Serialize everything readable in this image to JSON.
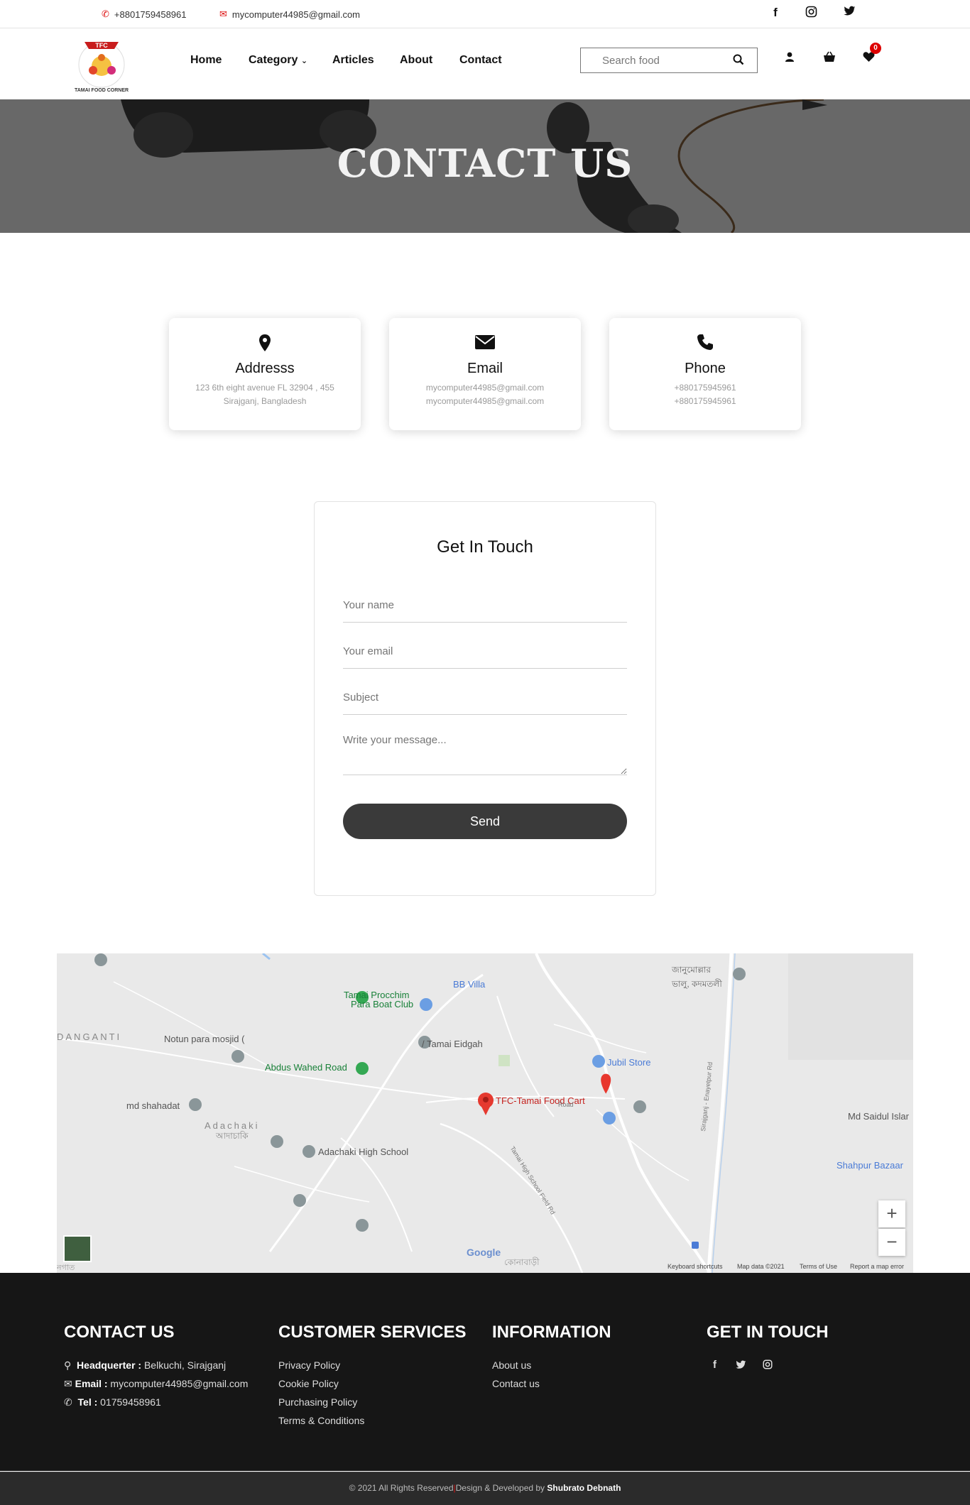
{
  "topbar": {
    "phone": "+8801759458961",
    "email": "mycomputer44985@gmail.com",
    "social_icons": [
      "facebook-icon",
      "instagram-icon",
      "twitter-icon"
    ]
  },
  "logo": {
    "badge": "TFC",
    "arc_text": "TAMAI FOOD CORNER"
  },
  "nav": {
    "items": [
      "Home",
      "Category",
      "Articles",
      "About",
      "Contact"
    ],
    "search_placeholder": "Search food",
    "wishlist_count": "0"
  },
  "hero": {
    "title": "CONTACT US"
  },
  "cards": [
    {
      "icon": "map-pin-icon",
      "title": "Addresss",
      "line1": "123 6th eight avenue FL 32904 , 455",
      "line2": "Sirajganj, Bangladesh"
    },
    {
      "icon": "envelope-icon",
      "title": "Email",
      "line1": "mycomputer44985@gmail.com",
      "line2": "mycomputer44985@gmail.com"
    },
    {
      "icon": "phone-icon",
      "title": "Phone",
      "line1": "+880175945961",
      "line2": "+880175945961"
    }
  ],
  "form": {
    "title": "Get In Touch",
    "name_placeholder": "Your name",
    "email_placeholder": "Your email",
    "subject_placeholder": "Subject",
    "message_placeholder": "Write your message...",
    "send_label": "Send"
  },
  "map": {
    "labels": {
      "tamai_procchim": "Tamai Procchim",
      "para_boat_club": "Para Boat Club",
      "bb_villa": "BB Villa",
      "bengali_top": "জানুমোল্লার ভালু, কদমতলী",
      "danganti": "DANGANTI",
      "notun_para": "Notun para mosjid (",
      "tamai_eidgah": "/ Tamai Eidgah",
      "abdus_wahed": "Abdus Wahed Road",
      "jubil_store": "Jubil Store",
      "md_shahadat": "md shahadat",
      "tfc_cart": "TFC-Tamai Food Cart",
      "md_saidul": "Md Saidul Islar",
      "adachaki": "Adachaki",
      "adachaki_bn": "আদাচাকি",
      "adachaki_school": "Adachaki High School",
      "shahpur": "Shahpur Bazaar",
      "road1": "Sirajganj - Enayetpur Rd",
      "road2": "Tamai High School Field Rd",
      "road3": "Road",
      "bengali_bottom": "কোনাবাড়ী",
      "bengali_left": "নগাত",
      "google": "Google",
      "keyboard": "Keyboard shortcuts",
      "map_data": "Map data ©2021",
      "terms": "Terms of Use",
      "report": "Report a map error"
    },
    "zoom_in": "+",
    "zoom_out": "−"
  },
  "footer": {
    "col1_title": "CONTACT US",
    "hq_label": "Headquerter :",
    "hq_value": "Belkuchi, Sirajganj",
    "email_label": "Email :",
    "email_value": "mycomputer44985@gmail.com",
    "tel_label": "Tel :",
    "tel_value": "01759458961",
    "col2_title": "CUSTOMER SERVICES",
    "services": [
      "Privacy Policy",
      "Cookie Policy",
      "Purchasing Policy",
      "Terms & Conditions"
    ],
    "col3_title": "INFORMATION",
    "info": [
      "About us",
      "Contact us"
    ],
    "col4_title": "GET IN TOUCH",
    "social_icons": [
      "facebook-icon",
      "twitter-icon",
      "instagram-icon"
    ]
  },
  "bottom": {
    "copyright": "© 2021 All Rights Reserved",
    "separator": "|",
    "design": "Design & Developed by",
    "author": "Shubrato Debnath"
  },
  "colors": {
    "accent_red": "#dd1111",
    "hero_bg": "#686868",
    "footer_bg": "#161616",
    "button_bg": "#3a3a3a"
  }
}
